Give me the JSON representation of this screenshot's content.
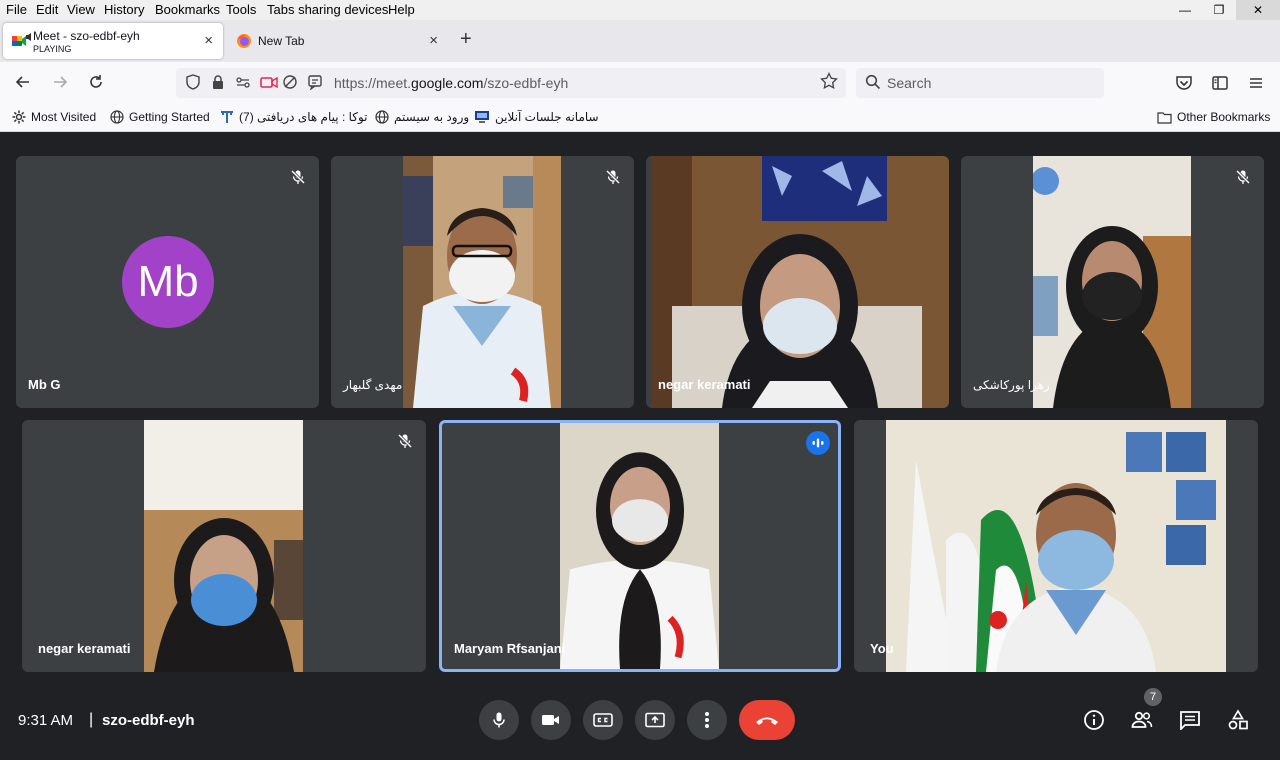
{
  "menu": {
    "items": [
      "File",
      "Edit",
      "View",
      "History",
      "Bookmarks",
      "Tools",
      "Tabs sharing devices",
      "Help"
    ]
  },
  "tabs": [
    {
      "title": "Meet - szo-edbf-eyh",
      "subtitle": "PLAYING",
      "close": "×"
    },
    {
      "title": "New Tab",
      "close": "×"
    }
  ],
  "new_tab": "+",
  "nav": {
    "url_prefix": "https://meet.",
    "url_domain": "google.com",
    "url_path": "/szo-edbf-eyh",
    "search_placeholder": "Search"
  },
  "bookmarks": [
    {
      "label": "Most Visited",
      "icon": "gear-icon"
    },
    {
      "label": "Getting Started",
      "icon": "globe-icon"
    },
    {
      "label": "توکا : پیام های دریافتی (7)",
      "icon": "toka-icon"
    },
    {
      "label": "ورود به سیستم",
      "icon": "globe-icon"
    },
    {
      "label": "سامانه جلسات آنلاین",
      "icon": "monitor-icon"
    },
    {
      "label": "Other Bookmarks",
      "icon": "folder-icon"
    }
  ],
  "participants": [
    {
      "name": "Mb G",
      "initials": "Mb",
      "muted": true,
      "avatar_color": "#a142c8"
    },
    {
      "name": "مهدی گلبهار",
      "muted": true
    },
    {
      "name": "negar keramati",
      "muted": false
    },
    {
      "name": "زهرا پورکاشکی",
      "muted": true
    },
    {
      "name": "negar keramati",
      "muted": true
    },
    {
      "name": "Maryam Rfsanjani",
      "muted": false,
      "speaking": true
    },
    {
      "name": "You",
      "muted": false
    }
  ],
  "bottom": {
    "time": "9:31 AM",
    "separator": "|",
    "meeting_code": "szo-edbf-eyh",
    "people_count": "7"
  },
  "colors": {
    "meet_bg": "#202124",
    "tile_bg": "#3c4043",
    "end_call": "#ea4335",
    "speaking_border": "#8ab4f8",
    "speaking_badge": "#1a73e8"
  }
}
